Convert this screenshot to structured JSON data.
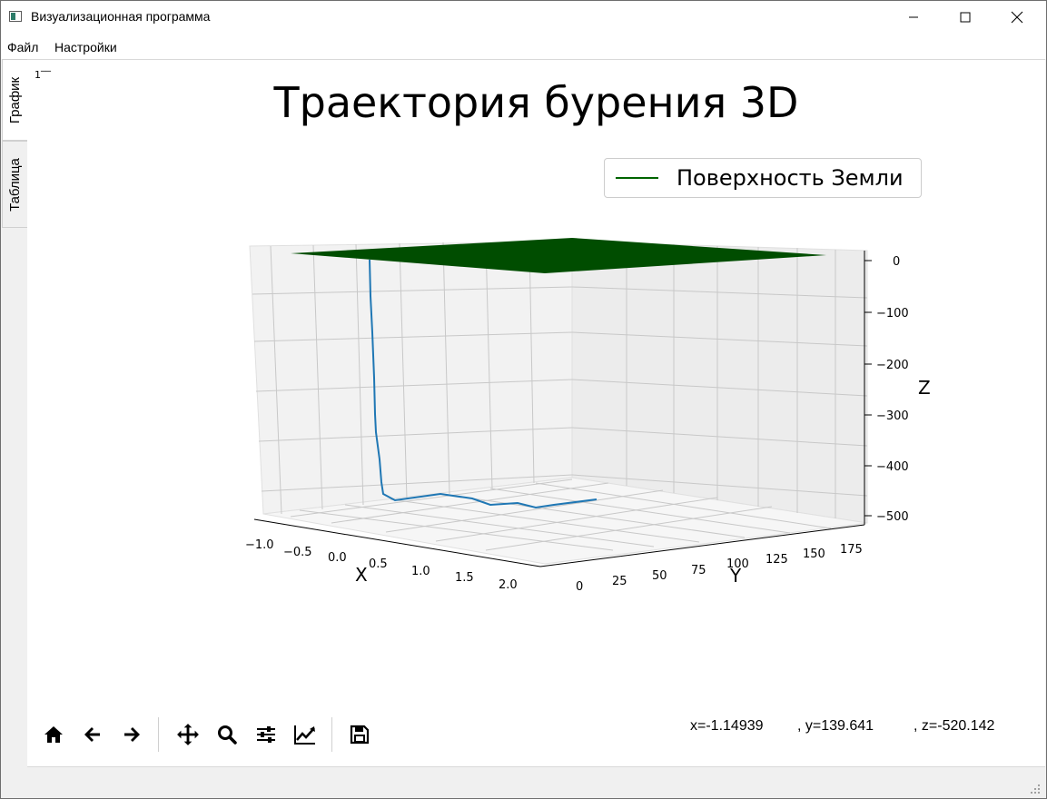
{
  "window": {
    "title": "Визуализационная программа",
    "icon": "app-window-icon"
  },
  "menu": {
    "items": [
      "Файл",
      "Настройки"
    ]
  },
  "tabs": [
    {
      "label": "График",
      "active": true
    },
    {
      "label": "Таблица",
      "active": false
    }
  ],
  "plot": {
    "stray_label": "1‾‾",
    "title": "Траектория бурения 3D",
    "legend": [
      {
        "label": "Поверхность Земли",
        "color": "#006400"
      }
    ]
  },
  "chart_data": {
    "type": "line3d",
    "title": "Траектория бурения 3D",
    "xlabel": "X",
    "ylabel": "Y",
    "zlabel": "Z",
    "x_ticks": [
      "−1.0",
      "−0.5",
      "0.0",
      "0.5",
      "1.0",
      "1.5",
      "2.0"
    ],
    "y_ticks": [
      "0",
      "25",
      "50",
      "75",
      "100",
      "125",
      "150",
      "175"
    ],
    "z_ticks": [
      "0",
      "−100",
      "−200",
      "−300",
      "−400",
      "−500"
    ],
    "xlim": [
      -1.2,
      2.2
    ],
    "ylim": [
      0,
      185
    ],
    "zlim": [
      -520,
      0
    ],
    "series": [
      {
        "name": "Поверхность Земли",
        "kind": "surface",
        "z": 0,
        "color": "#006400"
      },
      {
        "kind": "line",
        "color": "#1f77b4",
        "points": [
          {
            "x": 0.0,
            "y": 0,
            "z": 0
          },
          {
            "x": 0.0,
            "y": 0,
            "z": -100
          },
          {
            "x": 0.02,
            "y": 0,
            "z": -200
          },
          {
            "x": 0.03,
            "y": 0,
            "z": -300
          },
          {
            "x": 0.05,
            "y": 1,
            "z": -400
          },
          {
            "x": 0.08,
            "y": 2,
            "z": -440
          },
          {
            "x": 0.12,
            "y": 3,
            "z": -470
          },
          {
            "x": 0.2,
            "y": 5,
            "z": -500
          },
          {
            "x": 0.3,
            "y": 10,
            "z": -505
          },
          {
            "x": 0.4,
            "y": 20,
            "z": -500
          },
          {
            "x": 0.5,
            "y": 30,
            "z": -505
          },
          {
            "x": 0.6,
            "y": 45,
            "z": -510
          },
          {
            "x": 0.7,
            "y": 60,
            "z": -508
          },
          {
            "x": 0.75,
            "y": 80,
            "z": -512
          },
          {
            "x": 0.8,
            "y": 100,
            "z": -508
          },
          {
            "x": 0.85,
            "y": 120,
            "z": -510
          },
          {
            "x": 0.9,
            "y": 140,
            "z": -505
          },
          {
            "x": 1.0,
            "y": 160,
            "z": -500
          }
        ]
      }
    ],
    "grid": true,
    "legend_position": "top-right"
  },
  "toolbar": {
    "tools": [
      {
        "name": "home-icon"
      },
      {
        "name": "back-arrow-icon"
      },
      {
        "name": "forward-arrow-icon"
      },
      {
        "name": "pan-icon"
      },
      {
        "name": "zoom-icon"
      },
      {
        "name": "configure-subplots-icon"
      },
      {
        "name": "edit-axis-icon"
      },
      {
        "name": "save-icon"
      }
    ]
  },
  "coordinates": {
    "x": "x=-1.14939",
    "y": ", y=139.641",
    "z": ", z=-520.142"
  }
}
